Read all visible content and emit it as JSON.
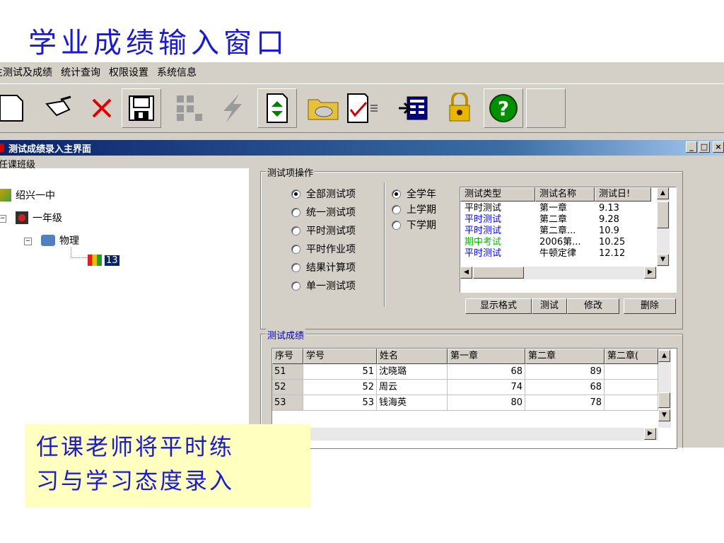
{
  "slide_title": "学业成绩输入窗口",
  "menu": [
    "主测试及成绩",
    "统计查询",
    "权限设置",
    "系统信息"
  ],
  "toolbar_icons": [
    "new-doc-icon",
    "edit-pen-icon",
    "delete-x-icon",
    "save-disk-icon",
    "grid-disabled-icon",
    "flash-disabled-icon",
    "refresh-doc-icon",
    "folder-icon",
    "report-doc-icon",
    "exit-panel-icon",
    "lock-key-icon",
    "help-icon"
  ],
  "inner_window": {
    "title": "测试成绩录入主界面",
    "controls": [
      "_",
      "□",
      "×"
    ]
  },
  "class_panel": {
    "label": "任课班级",
    "tree": [
      {
        "label": "绍兴一中",
        "icon": "school-icon"
      },
      {
        "label": "一年级",
        "icon": "grade-icon"
      },
      {
        "label": "物理",
        "icon": "subject-icon"
      },
      {
        "label": "13",
        "icon": "class-icon"
      }
    ]
  },
  "test_ops": {
    "label": "测试项操作",
    "test_types": [
      {
        "label": "全部测试项",
        "checked": true
      },
      {
        "label": "统一测试项",
        "checked": false
      },
      {
        "label": "平时测试项",
        "checked": false
      },
      {
        "label": "平时作业项",
        "checked": false
      },
      {
        "label": "结果计算项",
        "checked": false
      },
      {
        "label": "单一测试项",
        "checked": false
      }
    ],
    "periods": [
      {
        "label": "全学年",
        "checked": true
      },
      {
        "label": "上学期",
        "checked": false
      },
      {
        "label": "下学期",
        "checked": false
      }
    ],
    "list_headers": [
      "测试类型",
      "测试名称",
      "测试日!"
    ],
    "list_rows": [
      {
        "type": "平时测试",
        "name": "第一章",
        "date": "9.13",
        "color": "#000000"
      },
      {
        "type": "平时测试",
        "name": "第二章",
        "date": "9.28",
        "color": "#0000ff"
      },
      {
        "type": "平时测试",
        "name": "第二章...",
        "date": "10.9",
        "color": "#0000ff"
      },
      {
        "type": "期中考试",
        "name": "2006第...",
        "date": "10.25",
        "color": "#00c000"
      },
      {
        "type": "平时测试",
        "name": "牛顿定律",
        "date": "12.12",
        "color": "#0000ff"
      }
    ],
    "buttons": [
      "显示格式",
      "测试",
      "修改",
      "删除"
    ]
  },
  "scores": {
    "label": "测试成绩",
    "headers": [
      "序号",
      "学号",
      "姓名",
      "第一章",
      "第二章",
      "第二章("
    ],
    "rows": [
      {
        "seq": "51",
        "id": "51",
        "name": "沈晓璐",
        "ch1": "68",
        "ch2": "89",
        "ch2b": ""
      },
      {
        "seq": "52",
        "id": "52",
        "name": "周云",
        "ch1": "74",
        "ch2": "68",
        "ch2b": ""
      },
      {
        "seq": "53",
        "id": "53",
        "name": "钱海英",
        "ch1": "80",
        "ch2": "78",
        "ch2b": ""
      }
    ]
  },
  "note": {
    "line1": "任课老师将平时练",
    "line2": "习与学习态度录入"
  }
}
